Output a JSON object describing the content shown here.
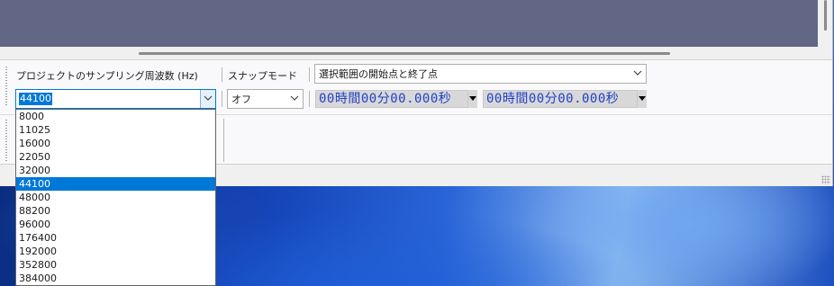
{
  "toolbar": {
    "sample_rate_label": "プロジェクトのサンプリング周波数 (Hz)",
    "snap_mode_label": "スナップモード",
    "selection_mode_value": "選択範囲の開始点と終了点",
    "sample_rate_value": "44100",
    "snap_value": "オフ",
    "selection_start_time": "00時間00分00.000秒",
    "selection_end_time": "00時間00分00.000秒"
  },
  "dropdown": {
    "items": [
      "8000",
      "11025",
      "16000",
      "22050",
      "32000",
      "44100",
      "48000",
      "88200",
      "96000",
      "176400",
      "192000",
      "352800",
      "384000"
    ],
    "selected_index": 5,
    "selected_value": "44100"
  },
  "icons": {
    "combo_arrow": "chevron-down-icon",
    "time_arrow": "triangle-down-icon",
    "toolbar_grip": "grip-dots-icon"
  },
  "colors": {
    "track_background": "#626786",
    "selection_highlight": "#0078d7",
    "time_text": "#2040c8"
  }
}
